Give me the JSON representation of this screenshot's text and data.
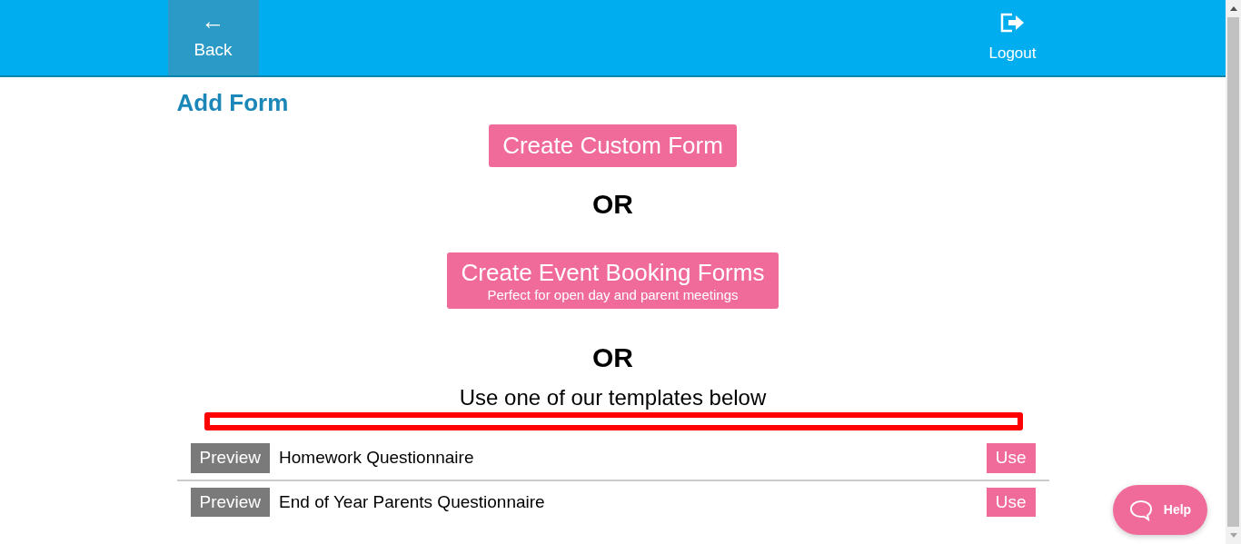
{
  "header": {
    "back": {
      "icon": "←",
      "label": "Back"
    },
    "logout": {
      "label": "Logout"
    }
  },
  "page_title": "Add Form",
  "custom_button": {
    "label": "Create Custom Form"
  },
  "separators": [
    "OR",
    "OR"
  ],
  "event_button": {
    "label": "Create Event Booking Forms",
    "subtitle": "Perfect for open day and parent meetings"
  },
  "templates_intro": "Use one of our templates below",
  "templates": [
    {
      "preview": "Preview",
      "name": "Homework Questionnaire",
      "use": "Use"
    },
    {
      "preview": "Preview",
      "name": "End of Year Parents Questionnaire",
      "use": "Use"
    }
  ],
  "help_button": {
    "label": "Help"
  }
}
